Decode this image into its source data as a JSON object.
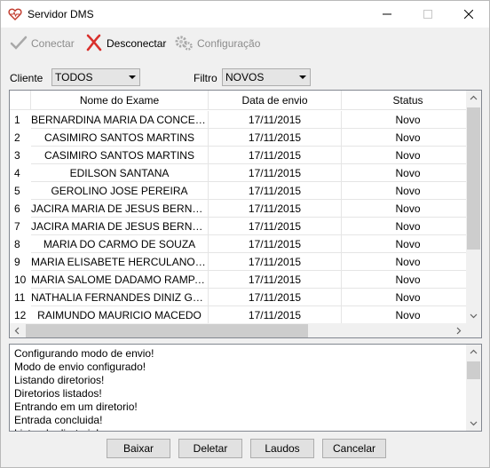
{
  "window": {
    "title": "Servidor DMS"
  },
  "toolbar": {
    "connect_label": "Conectar",
    "disconnect_label": "Desconectar",
    "config_label": "Configuração"
  },
  "filters": {
    "client_label": "Cliente",
    "client_value": "TODOS",
    "filter_label": "Filtro",
    "filter_value": "NOVOS"
  },
  "table": {
    "columns": [
      "Nome do Exame",
      "Data de envio",
      "Status"
    ],
    "rows": [
      {
        "num": "1",
        "name": "BERNARDINA MARIA DA CONCEICAO",
        "date": "17/11/2015",
        "status": "Novo"
      },
      {
        "num": "2",
        "name": "CASIMIRO SANTOS MARTINS",
        "date": "17/11/2015",
        "status": "Novo"
      },
      {
        "num": "3",
        "name": "CASIMIRO SANTOS MARTINS",
        "date": "17/11/2015",
        "status": "Novo"
      },
      {
        "num": "4",
        "name": "EDILSON SANTANA",
        "date": "17/11/2015",
        "status": "Novo"
      },
      {
        "num": "5",
        "name": "GEROLINO JOSE PEREIRA",
        "date": "17/11/2015",
        "status": "Novo"
      },
      {
        "num": "6",
        "name": "JACIRA MARIA DE JESUS BERNARDES",
        "date": "17/11/2015",
        "status": "Novo"
      },
      {
        "num": "7",
        "name": "JACIRA MARIA DE JESUS BERNARDES",
        "date": "17/11/2015",
        "status": "Novo"
      },
      {
        "num": "8",
        "name": "MARIA DO  CARMO DE SOUZA",
        "date": "17/11/2015",
        "status": "Novo"
      },
      {
        "num": "9",
        "name": "MARIA ELISABETE HERCULANO DOS ...",
        "date": "17/11/2015",
        "status": "Novo"
      },
      {
        "num": "10",
        "name": "MARIA SALOME DADAMO RAMPASSO",
        "date": "17/11/2015",
        "status": "Novo"
      },
      {
        "num": "11",
        "name": "NATHALIA FERNANDES DINIZ GALLEO...",
        "date": "17/11/2015",
        "status": "Novo"
      },
      {
        "num": "12",
        "name": "RAIMUNDO MAURICIO MACEDO",
        "date": "17/11/2015",
        "status": "Novo"
      }
    ]
  },
  "log": {
    "lines": [
      "Configurando modo de envio!",
      "Modo de envio configurado!",
      "Listando diretorios!",
      "Diretorios listados!",
      "Entrando em um diretorio!",
      "Entrada concluida!",
      "Listando diretorio!"
    ]
  },
  "buttons": {
    "lower": "Baixar",
    "delete": "Deletar",
    "reports": "Laudos",
    "cancel": "Cancelar"
  },
  "colors": {
    "window_bg": "#f0f0f0",
    "disconnect_icon": "#d9302c",
    "connect_icon_disabled": "#a8a8a8"
  }
}
